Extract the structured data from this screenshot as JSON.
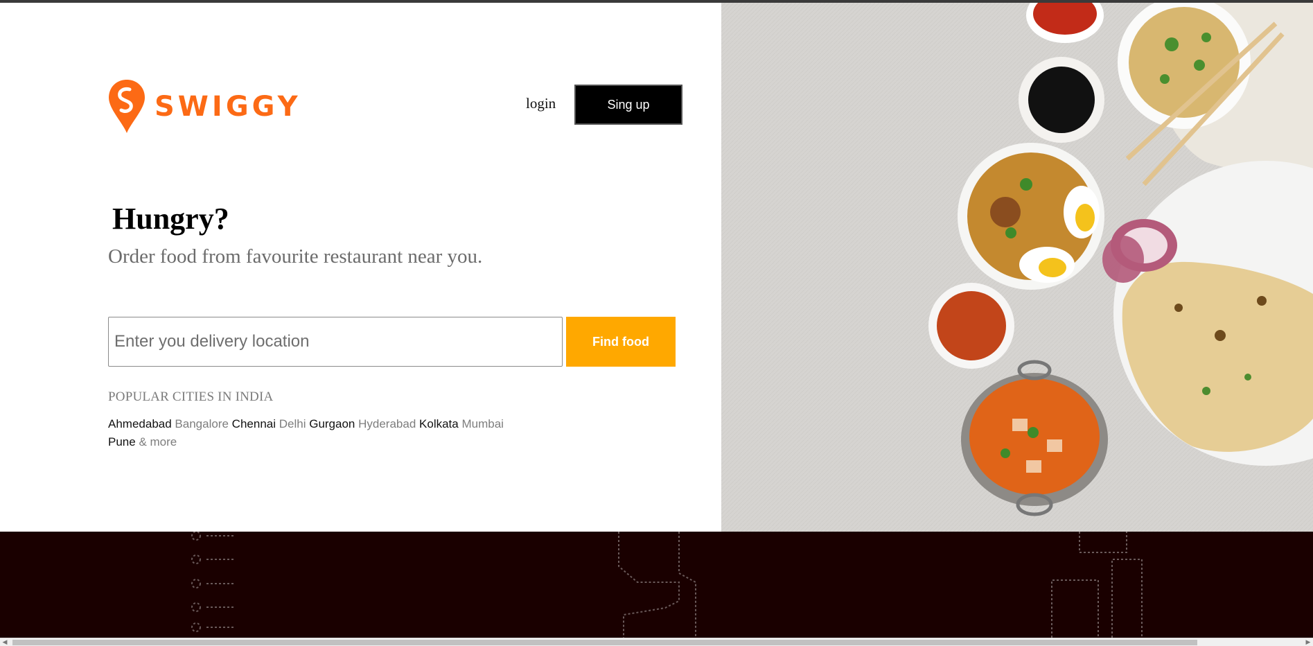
{
  "brand": {
    "name": "SWIGGY",
    "color": "#fc6a15"
  },
  "header": {
    "login_label": "login",
    "signup_label": "Sing up"
  },
  "hero": {
    "title": "Hungry?",
    "subtitle": "Order food from favourite restaurant near you."
  },
  "search": {
    "placeholder": "Enter you delivery location",
    "value": "",
    "button_label": "Find food",
    "button_color": "#ffa800"
  },
  "popular": {
    "title": "POPULAR CITIES IN INDIA",
    "cities": [
      "Ahmedabad",
      "Bangalore",
      "Chennai",
      "Delhi",
      "Gurgaon",
      "Hyderabad",
      "Kolkata",
      "Mumbai",
      "Pune",
      "& more"
    ]
  },
  "icons": {
    "logo": "swiggy-pin-icon",
    "scroll_left": "chevron-left-icon",
    "scroll_right": "chevron-right-icon"
  }
}
